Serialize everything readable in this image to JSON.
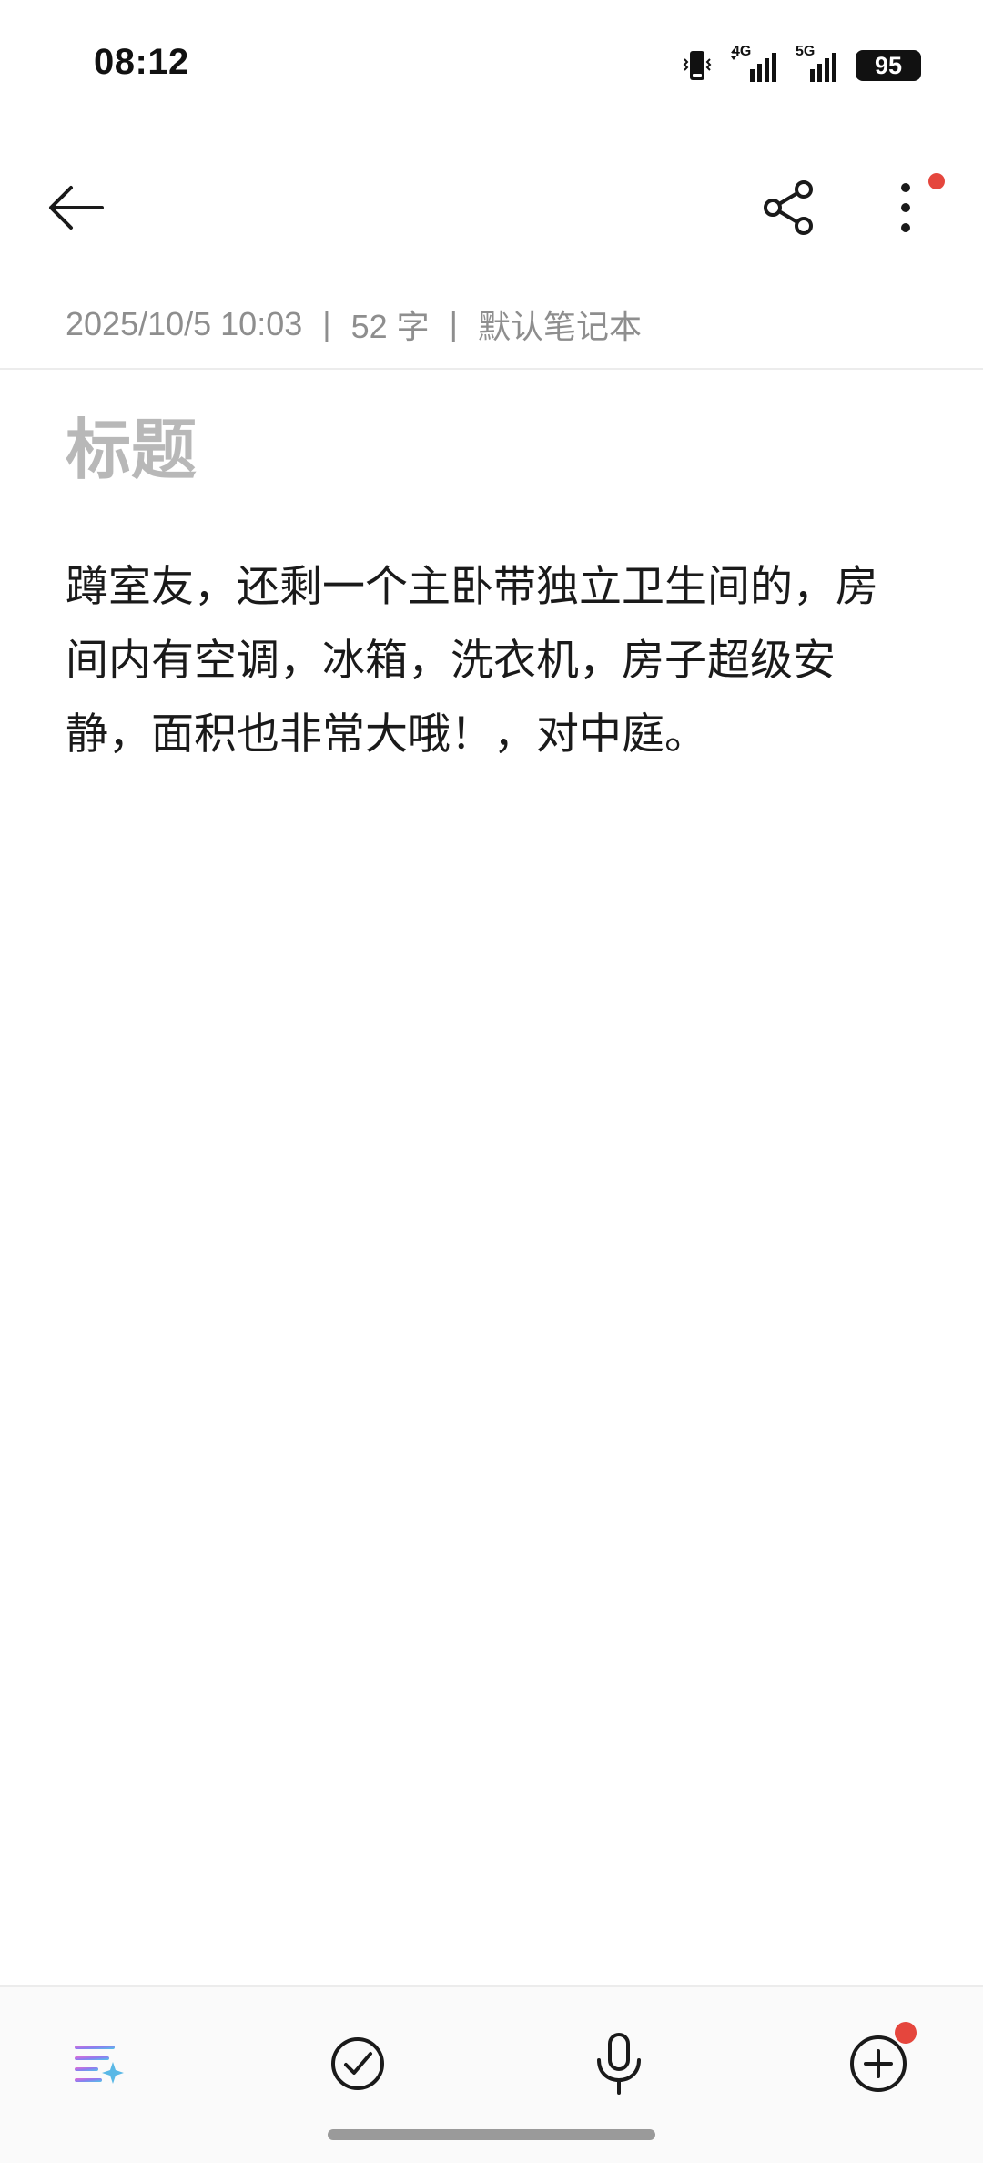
{
  "status_bar": {
    "time": "08:12",
    "network_1": "4G",
    "network_2": "5G",
    "battery": "95",
    "icons": [
      "vibrate-icon",
      "signal-4g-icon",
      "signal-5g-icon",
      "battery-icon"
    ]
  },
  "app_bar": {
    "icons": [
      "back-arrow-icon",
      "share-icon",
      "more-vertical-icon"
    ],
    "accent_color": "#e5463d"
  },
  "meta": {
    "datetime": "2025/10/5 10:03",
    "separator": "|",
    "word_count": "52 字",
    "notebook": "默认笔记本"
  },
  "note": {
    "title_placeholder": "标题",
    "body": "蹲室友，还剩一个主卧带独立卫生间的，房间内有空调，冰箱，洗衣机，房子超级安静，面积也非常大哦！，对中庭。"
  },
  "toolbar": {
    "icons": [
      "ai-format-icon",
      "checklist-icon",
      "microphone-icon",
      "add-icon"
    ]
  }
}
